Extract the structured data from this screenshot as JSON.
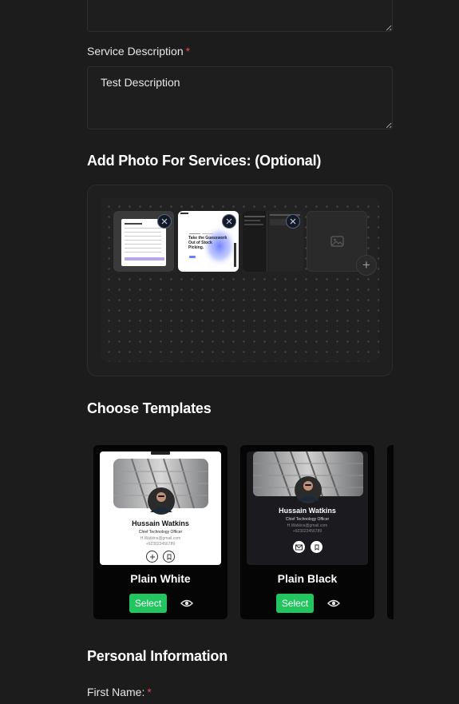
{
  "form": {
    "service_description": {
      "label": "Service Description",
      "required_mark": "*",
      "value": "Test Description"
    },
    "photos": {
      "title": "Add Photo For Services: (Optional)",
      "items": [
        {
          "name": "photo-1",
          "removable": true
        },
        {
          "name": "photo-2",
          "removable": true
        },
        {
          "name": "photo-3",
          "removable": true
        },
        {
          "name": "photo-placeholder",
          "removable": false
        }
      ],
      "thumb_text": {
        "photo2_headline": "Take the Guesswork Out of Stock Picking."
      }
    },
    "templates": {
      "title": "Choose Templates",
      "cards": [
        {
          "name": "Plain White",
          "select_label": "Select",
          "preview": {
            "person": "Hussain Watkins",
            "role": "Chief Technology Officer",
            "email": "H.Watkins@gmail.com",
            "phone": "+923023456789"
          }
        },
        {
          "name": "Plain Black",
          "select_label": "Select",
          "preview": {
            "person": "Hussain Watkins",
            "role": "Chief Technology Officer",
            "email": "H.Watkins@gmail.com",
            "phone": "+923023456789"
          }
        }
      ]
    },
    "personal_info": {
      "title": "Personal Information",
      "first_name_label": "First Name:",
      "required_mark": "*"
    }
  },
  "colors": {
    "background": "#1c1c1c",
    "accent_select": "#22c55e",
    "required": "#e5484d"
  }
}
